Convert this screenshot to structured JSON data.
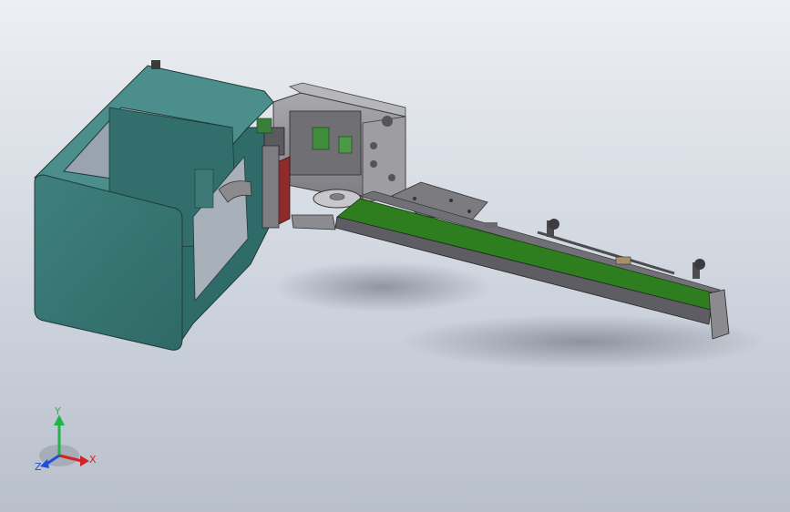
{
  "triad": {
    "x_label": "X",
    "y_label": "Y",
    "z_label": "Z",
    "x_color": "#d32222",
    "y_color": "#22b34a",
    "z_color": "#1f4fd6"
  },
  "model": {
    "housing_color": "#3f7f7c",
    "conveyor_belt_color": "#2e7d1f",
    "frame_color": "#6e6e73"
  }
}
